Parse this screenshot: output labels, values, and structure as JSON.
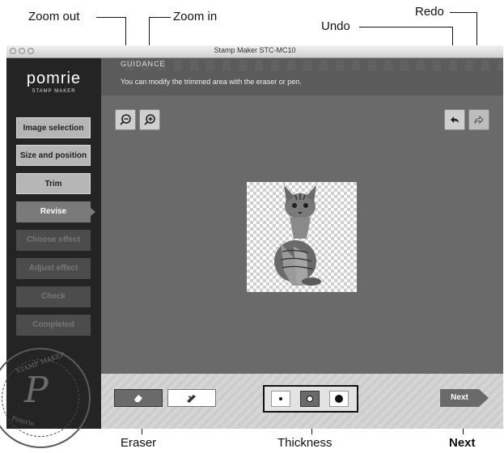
{
  "callouts": {
    "zoom_out": "Zoom out",
    "zoom_in": "Zoom in",
    "undo": "Undo",
    "redo": "Redo",
    "eraser": "Eraser",
    "thickness": "Thickness",
    "next": "Next"
  },
  "window": {
    "title": "Stamp Maker STC-MC10"
  },
  "sidebar": {
    "logo": "pomrie",
    "logo_sub": "STAMP MAKER",
    "steps": [
      {
        "label": "Image selection",
        "state": "done"
      },
      {
        "label": "Size and position",
        "state": "done"
      },
      {
        "label": "Trim",
        "state": "done"
      },
      {
        "label": "Revise",
        "state": "current"
      },
      {
        "label": "Choose effect",
        "state": "todo"
      },
      {
        "label": "Adjust effect",
        "state": "todo"
      },
      {
        "label": "Check",
        "state": "todo"
      },
      {
        "label": "Completed",
        "state": "todo"
      }
    ],
    "seal_text_top": "STAMP MAKER",
    "seal_text_bottom": "Pomrie"
  },
  "guidance": {
    "title": "GUIDANCE",
    "text": "You can modify the trimmed area with the eraser or pen."
  },
  "toolbar_icons": {
    "zoom_out": "zoom-out-icon",
    "zoom_in": "zoom-in-icon",
    "undo": "undo-icon",
    "redo": "redo-icon"
  },
  "bottom": {
    "eraser_icon": "eraser-icon",
    "pen_icon": "pen-icon",
    "thickness_options": [
      "small",
      "medium",
      "large"
    ],
    "selected_thickness": "medium",
    "next_label": "Next"
  }
}
